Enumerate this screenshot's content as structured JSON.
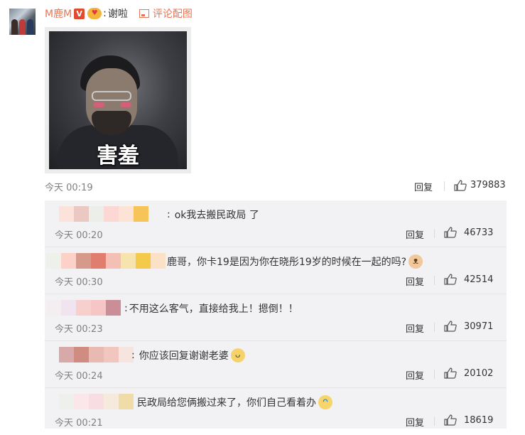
{
  "comment": {
    "username": "M鹿M",
    "verified_icon": "v-badge-icon",
    "vip_icon": "heart-emoji-icon",
    "colon": ":",
    "text": "谢啦",
    "pic_link": "评论配图",
    "image_caption": "害羞",
    "time": "今天 00:19",
    "reply_label": "回复",
    "likes": "379883"
  },
  "replies": [
    {
      "text": "ok我去搬民政局 了",
      "time": "今天 00:20",
      "reply_label": "回复",
      "likes": "46733",
      "emoji": ""
    },
    {
      "text": "鹿哥，你卡19是因为你在晓彤19岁的时候在一起的吗?",
      "time": "今天 00:30",
      "reply_label": "回复",
      "likes": "42514",
      "emoji": "cat-face-icon"
    },
    {
      "text": "不用这么客气，直接给我上！摁倒！！",
      "time": "今天 00:23",
      "reply_label": "回复",
      "likes": "30971",
      "emoji": ""
    },
    {
      "text": "你应该回复谢谢老婆",
      "time": "今天 00:24",
      "reply_label": "回复",
      "likes": "20102",
      "emoji": "doge-face-icon"
    },
    {
      "text": "民政局给您俩搬过来了，你们自己看着办",
      "time": "今天 00:21",
      "reply_label": "回复",
      "likes": "18619",
      "emoji": "laugh-cry-icon"
    }
  ],
  "colors": {
    "username": "#eb7350",
    "reply_bg": "#f2f2f5",
    "meta_text": "#808080"
  }
}
